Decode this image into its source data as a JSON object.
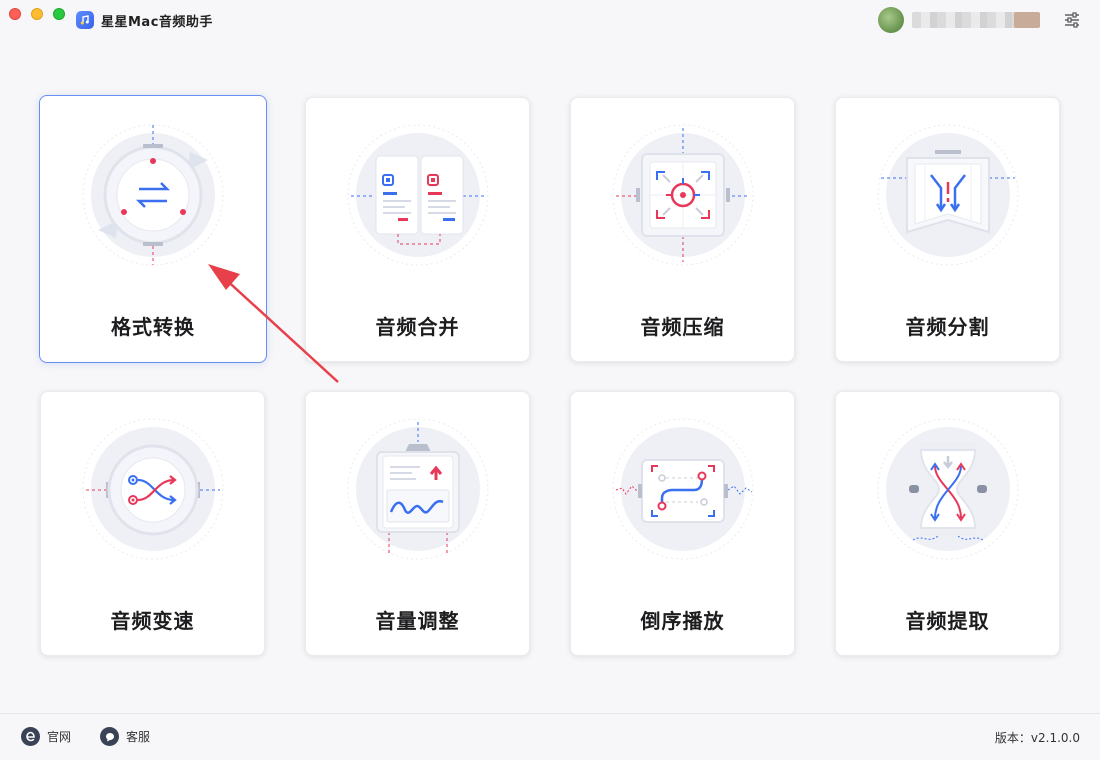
{
  "app": {
    "title": "星星Mac音频助手"
  },
  "cards": [
    {
      "label": "格式转换",
      "icon": "format-convert-icon"
    },
    {
      "label": "音频合并",
      "icon": "audio-merge-icon"
    },
    {
      "label": "音频压缩",
      "icon": "audio-compress-icon"
    },
    {
      "label": "音频分割",
      "icon": "audio-split-icon"
    },
    {
      "label": "音频变速",
      "icon": "audio-speed-icon"
    },
    {
      "label": "音量调整",
      "icon": "volume-adjust-icon"
    },
    {
      "label": "倒序播放",
      "icon": "reverse-play-icon"
    },
    {
      "label": "音频提取",
      "icon": "audio-extract-icon"
    }
  ],
  "footer": {
    "website_label": "官网",
    "support_label": "客服",
    "version": "版本：v2.1.0.0"
  },
  "colors": {
    "accent_blue": "#3a6ff0",
    "accent_red": "#e8385a",
    "selected_border": "#6a8ff2"
  }
}
